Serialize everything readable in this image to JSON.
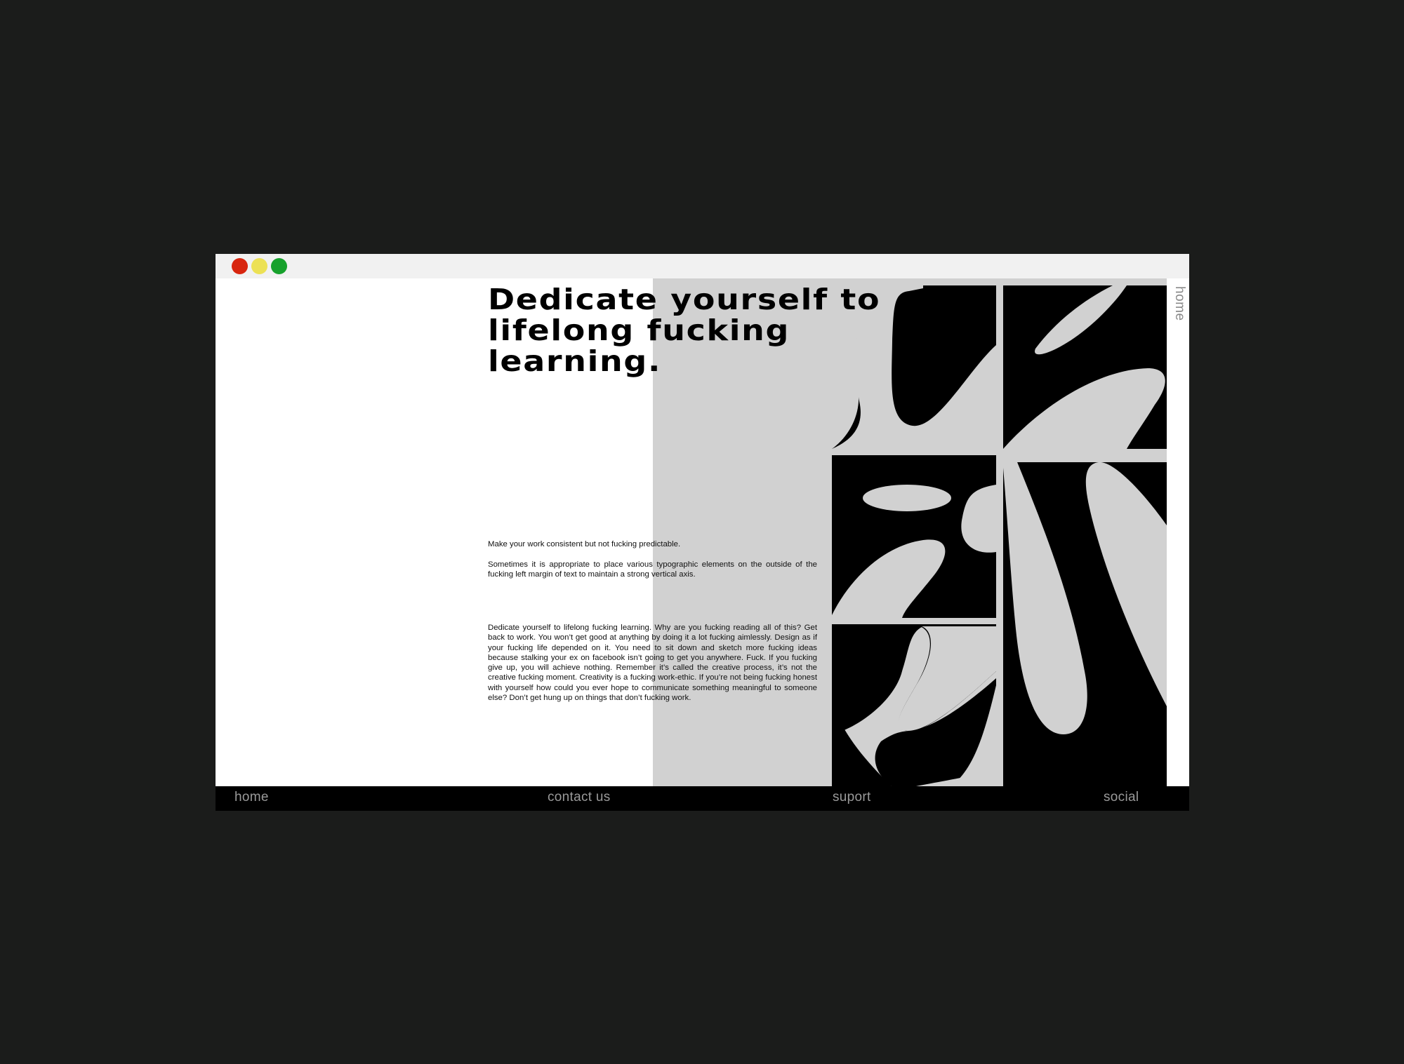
{
  "window": {
    "controls": {
      "close_color": "#d8260f",
      "minimize_color": "#ece155",
      "maximize_color": "#17a12c"
    }
  },
  "main": {
    "headline": "Dedicate yourself to lifelong fucking learning.",
    "paragraph_1": "Make your work consistent but not fucking predictable.",
    "paragraph_2": "Sometimes it is appropriate to place various typographic elements on the outside of the fucking left margin of text to maintain a strong vertical axis.",
    "paragraph_3": "Dedicate yourself to lifelong fucking learning. Why are you fucking reading all of this? Get back to work. You won’t get good at anything by doing it a lot fucking aimlessly. Design as if your fucking life depended on it. You need to sit down and sketch more fucking ideas because stalking your ex on facebook isn’t going to get you anywhere. Fuck. If you fucking give up, you will achieve nothing. Remember it’s called the creative process, it’s not the creative fucking moment. Creativity is a fucking work-ethic. If you’re not being fucking honest with yourself how could you ever hope to communicate something meaningful to someone else? Don’t get hung up on things that don’t fucking work."
  },
  "side_nav": {
    "label": "home"
  },
  "footer": {
    "home": "home",
    "contact": "contact us",
    "support": "suport",
    "social": "social"
  },
  "colors": {
    "background": "#1b1c1b",
    "panel_grey": "#d1d1d1",
    "ink": "#000000"
  }
}
